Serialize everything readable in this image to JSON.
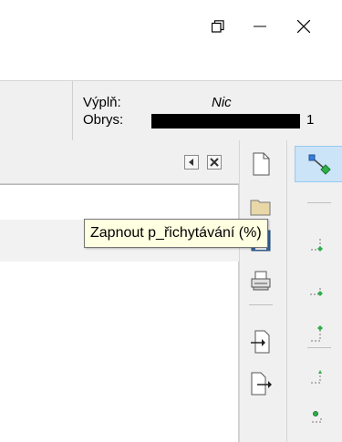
{
  "window": {
    "minimize_icon": "minimize-icon",
    "restore_icon": "restore-icon",
    "close_icon": "close-icon"
  },
  "status": {
    "fill_label": "Výplň:",
    "fill_value": "Nic",
    "stroke_label": "Obrys:",
    "stroke_color": "#000000",
    "stroke_width": "1"
  },
  "panel": {
    "collapse_icon": "collapse-left-icon",
    "close_icon": "panel-close-icon"
  },
  "commands_toolbar": {
    "buttons": [
      "new-document-icon",
      "open-folder-icon",
      "save-icon",
      "print-icon",
      "import-icon",
      "export-icon"
    ]
  },
  "snap_toolbar": {
    "toggle_icon": "snap-toggle-icon",
    "accent": "#cce4f7"
  },
  "tooltip": {
    "text": "Zapnout p_řichytávání (%)"
  }
}
